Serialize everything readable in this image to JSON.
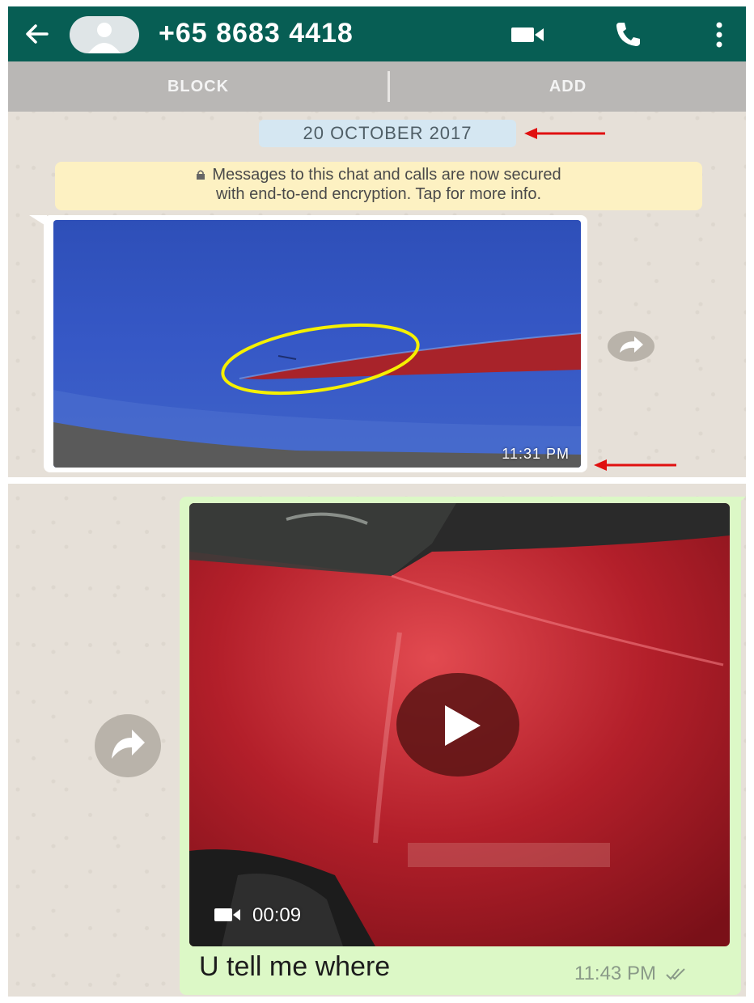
{
  "header": {
    "contact_name": "+65 8683 4418",
    "back_icon": "arrow-left-icon",
    "avatar_icon": "default-avatar-icon",
    "video_call_icon": "video-camera-icon",
    "voice_call_icon": "phone-icon",
    "menu_icon": "more-vertical-icon",
    "color": "#075e54"
  },
  "action_bar": {
    "block_label": "BLOCK",
    "add_label": "ADD"
  },
  "chat": {
    "date_label": "20 OCTOBER 2017",
    "encryption_notice_line1": "Messages to this chat and calls are now secured",
    "encryption_notice_line2": "with end-to-end encryption. Tap for more info.",
    "lock_icon": "lock-icon",
    "messages": [
      {
        "direction": "incoming",
        "kind": "image",
        "time": "11:31 PM",
        "forward_icon": "forward-icon"
      },
      {
        "direction": "outgoing",
        "kind": "video",
        "duration": "00:09",
        "caption": "U tell me where",
        "time": "11:43 PM",
        "status_icon": "double-check-icon",
        "forward_icon": "forward-icon"
      }
    ]
  },
  "annotations": {
    "arrow_color": "#e01010",
    "circle_color": "#f5f000"
  }
}
